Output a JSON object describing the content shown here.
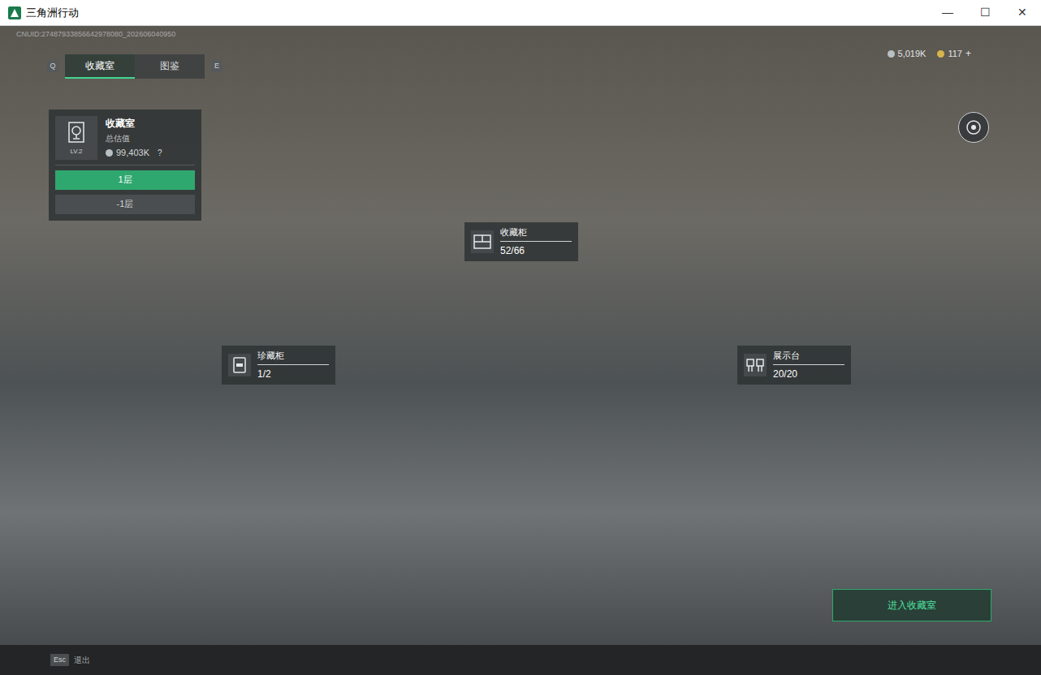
{
  "window": {
    "title": "三角洲行动",
    "controls": [
      "—",
      "☐",
      "✕"
    ]
  },
  "uid": "CNUID:27487933856642978080_202606040950",
  "tabs": [
    {
      "label": "收藏室",
      "selected": true
    },
    {
      "label": "图鉴",
      "selected": false
    }
  ],
  "tab_keys": {
    "left": "Q",
    "right": "E"
  },
  "currency": [
    {
      "amount": "5,019K",
      "color": "#b8c0c4"
    },
    {
      "amount": "117",
      "color": "#d8b54a"
    }
  ],
  "currency_add": "+",
  "room_panel": {
    "title": "收藏室",
    "value_label": "总估值",
    "value": "99,403K",
    "help": "?",
    "level": "LV.2",
    "floors": [
      {
        "label": "1层",
        "selected": true
      },
      {
        "label": "-1层",
        "selected": false
      }
    ]
  },
  "hotspots": [
    {
      "label": "收藏柜",
      "count": "52/66",
      "kind": "cabinet"
    },
    {
      "label": "珍藏柜",
      "count": "1/2",
      "kind": "vault"
    },
    {
      "label": "展示台",
      "count": "20/20",
      "kind": "stand"
    }
  ],
  "enter_button": "进入收藏室",
  "footer": {
    "key": "Esc",
    "label": "退出"
  }
}
